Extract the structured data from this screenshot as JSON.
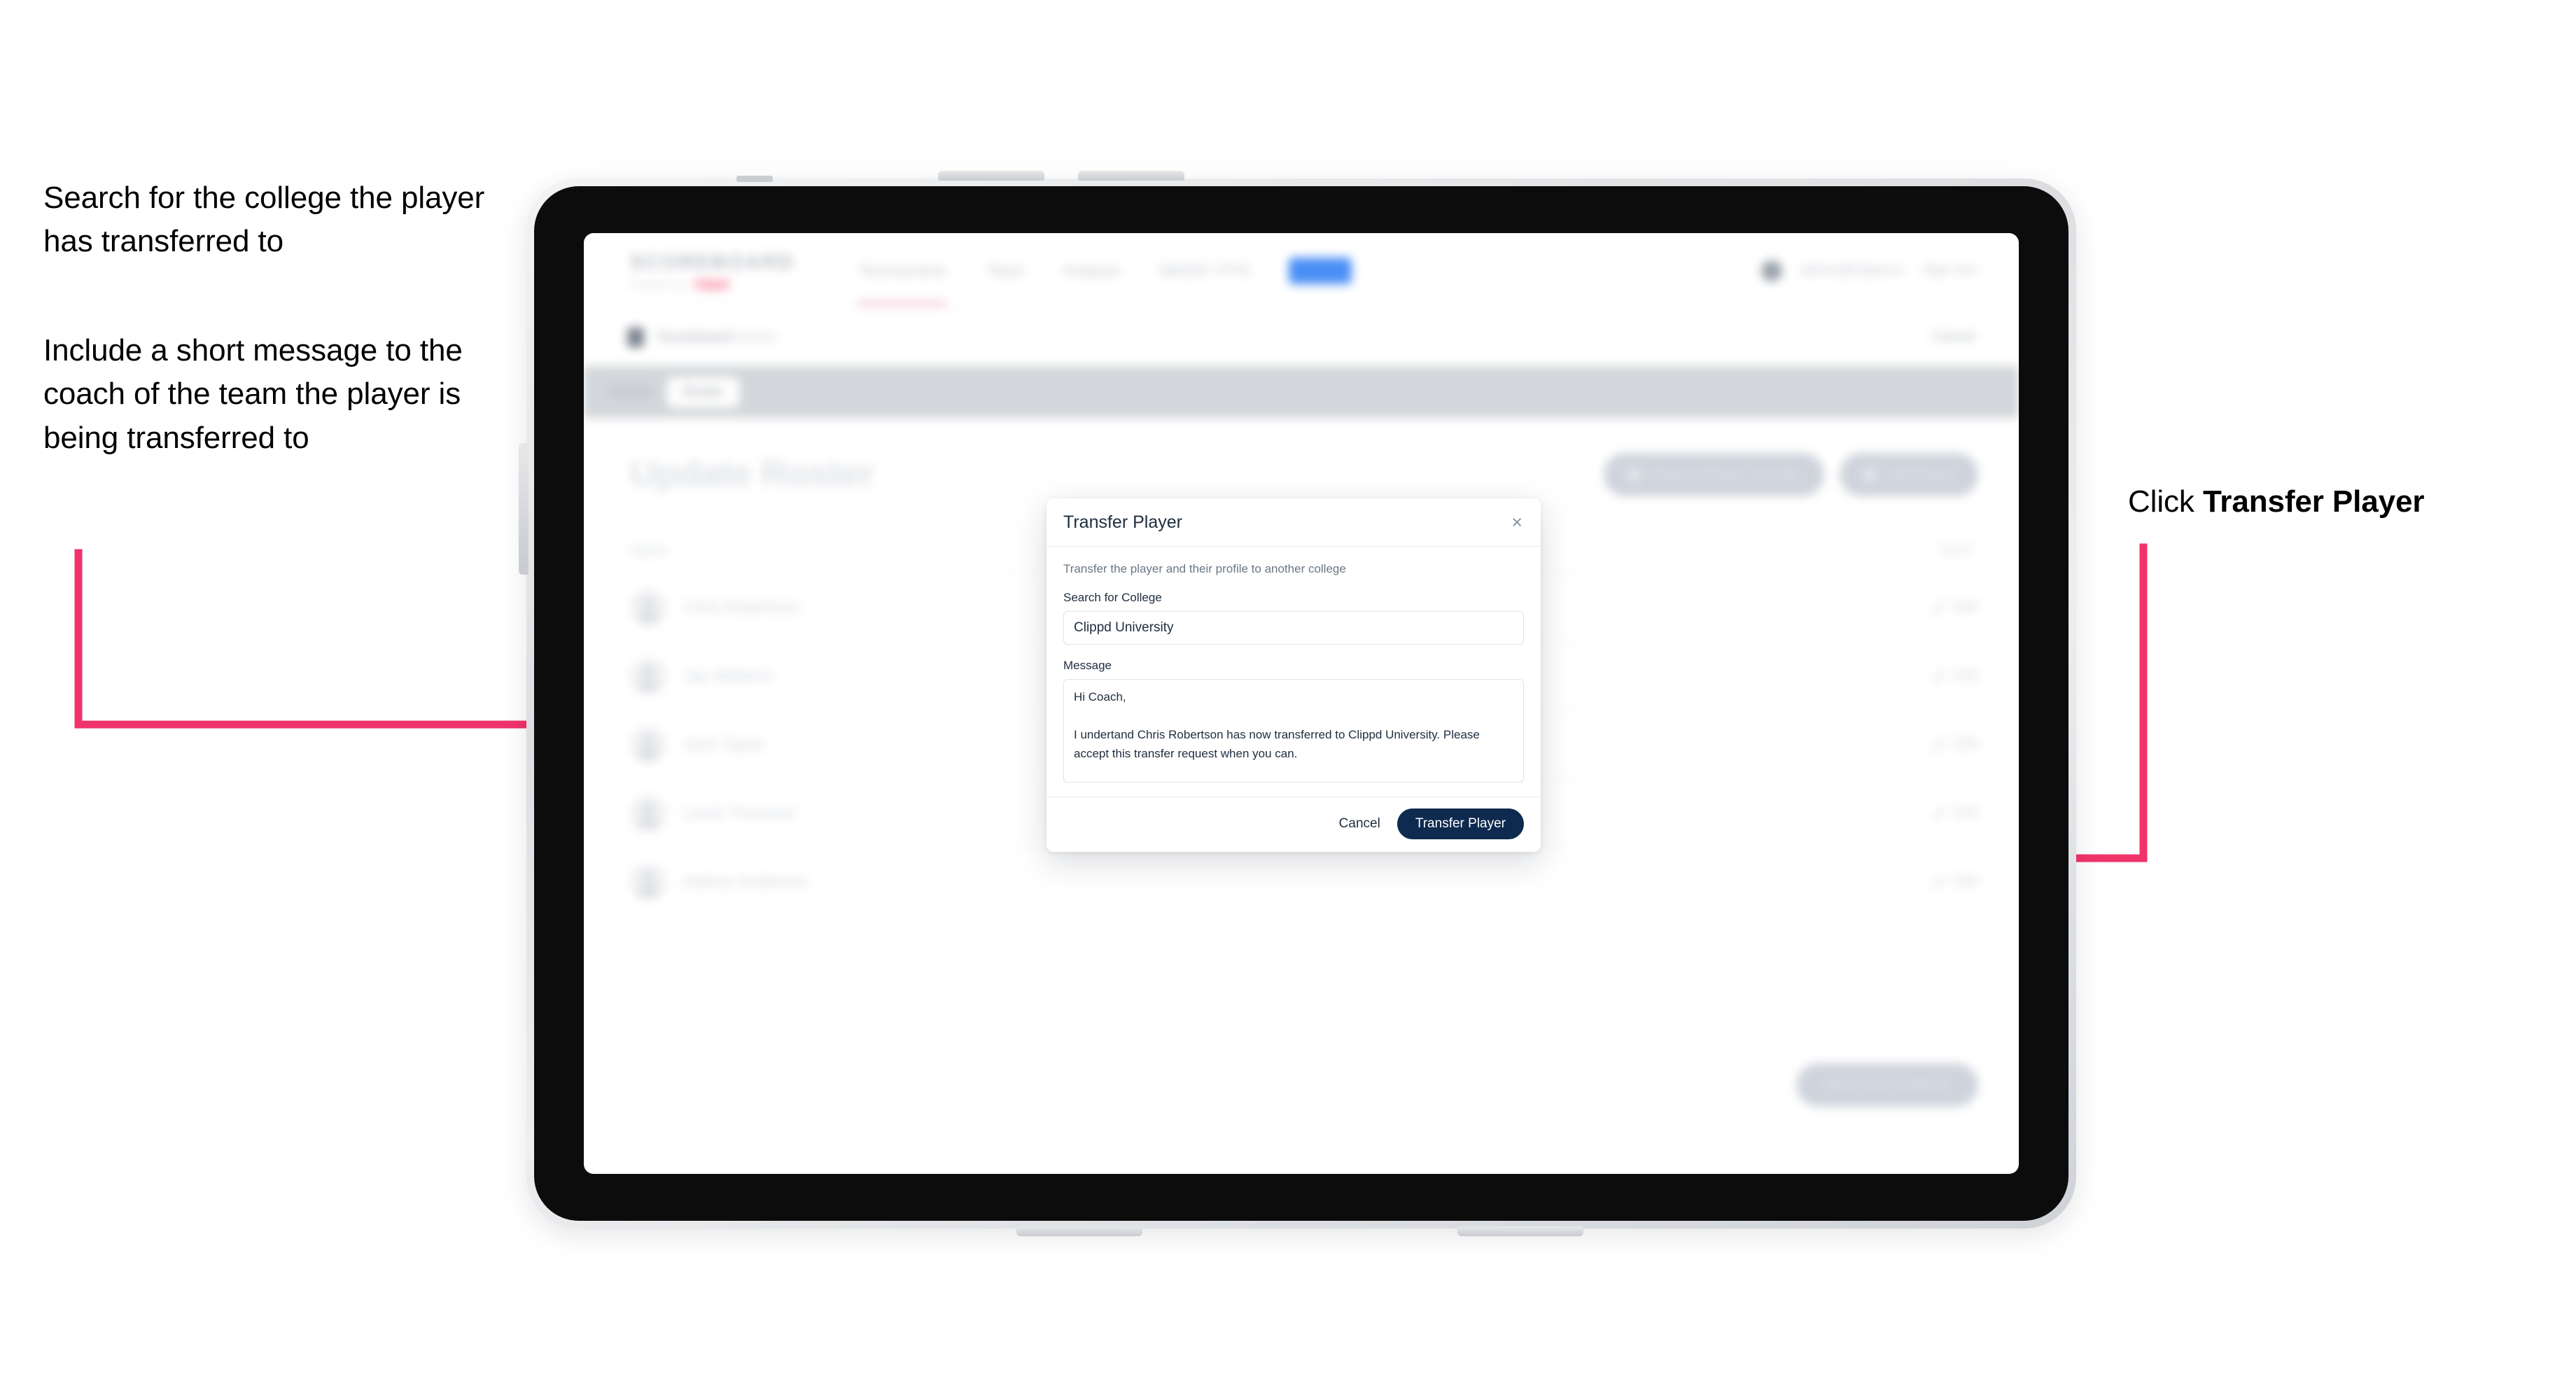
{
  "annotations": {
    "left_1": "Search for the college the player has transferred to",
    "left_2": "Include a short message to the coach of the team the player is being transferred to",
    "right_prefix": "Click ",
    "right_bold": "Transfer Player"
  },
  "colors": {
    "arrow": "#f0336b",
    "primary_button": "#0e2a4f",
    "brand_accent": "#f2607f",
    "text_dark": "#1f2d3f"
  },
  "app": {
    "logo": "SCOREBOARD",
    "logo_sub": "Powered by",
    "logo_badge": "Clippd",
    "nav": [
      {
        "label": "Tournaments"
      },
      {
        "label": "Team"
      },
      {
        "label": "Analysis"
      },
      {
        "label": "WAGR / PTS"
      },
      {
        "label": "Admin"
      }
    ],
    "nav_right": {
      "user": "admin@clippd.io",
      "signout": "Sign Out"
    },
    "breadcrumb": {
      "title": "Scoreboard",
      "sub": "Admin",
      "action": "Cancel"
    },
    "tabs": [
      {
        "label": "Details",
        "active": false
      },
      {
        "label": "Roster",
        "active": true
      }
    ],
    "page_title": "Update Roster",
    "header_actions": [
      {
        "label": "Request Player Transfer"
      },
      {
        "label": "Add Player"
      }
    ],
    "table": {
      "col_name": "Name",
      "col_action": "EDIT",
      "rows": [
        {
          "name": "Chris Robertson",
          "action": "Edit"
        },
        {
          "name": "Jay Williams",
          "action": "Edit"
        },
        {
          "name": "John Taylor",
          "action": "Edit"
        },
        {
          "name": "Lewis Thomson",
          "action": "Edit"
        },
        {
          "name": "Nathan Anderson",
          "action": "Edit"
        }
      ]
    },
    "footer_button": "Save And Continue"
  },
  "modal": {
    "title": "Transfer Player",
    "close_icon": "×",
    "description": "Transfer the player and their profile to another college",
    "college_label": "Search for College",
    "college_value": "Clippd University",
    "college_placeholder": "Search for College",
    "message_label": "Message",
    "message_value": "Hi Coach,\n\nI undertand Chris Robertson has now transferred to Clippd University. Please accept this transfer request when you can.",
    "message_placeholder": "Message",
    "cancel_label": "Cancel",
    "submit_label": "Transfer Player"
  }
}
